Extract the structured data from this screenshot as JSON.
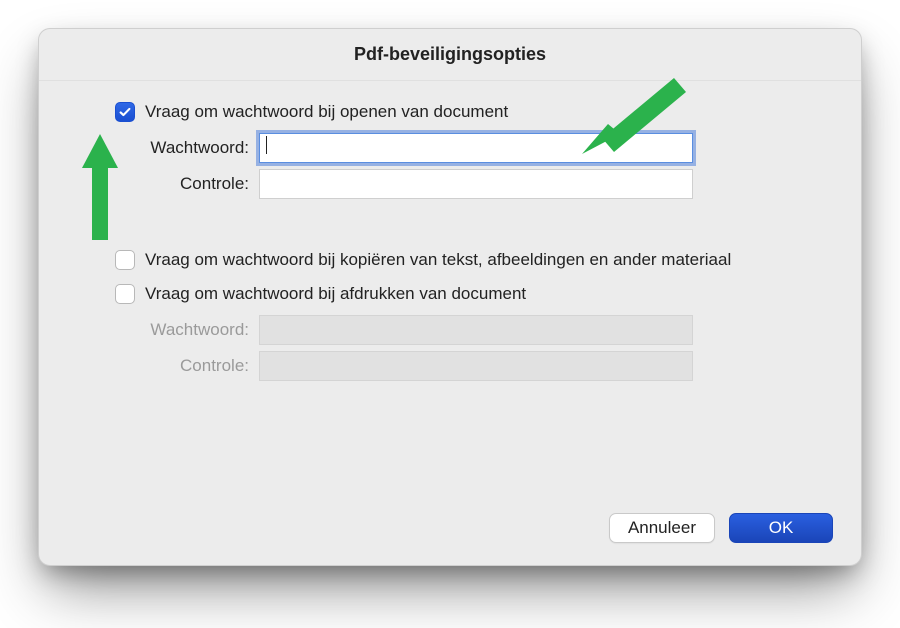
{
  "title": "Pdf-beveiligingsopties",
  "open": {
    "checkbox_label": "Vraag om wachtwoord bij openen van document",
    "checked": true,
    "password_label": "Wachtwoord:",
    "password_value": "",
    "verify_label": "Controle:",
    "verify_value": ""
  },
  "perm": {
    "copy_label": "Vraag om wachtwoord bij kopiëren van tekst, afbeeldingen en ander materiaal",
    "copy_checked": false,
    "print_label": "Vraag om wachtwoord bij afdrukken van document",
    "print_checked": false,
    "password_label": "Wachtwoord:",
    "verify_label": "Controle:"
  },
  "buttons": {
    "cancel": "Annuleer",
    "ok": "OK"
  },
  "colors": {
    "accent": "#1a4fd1",
    "annotation": "#2bb24c"
  }
}
